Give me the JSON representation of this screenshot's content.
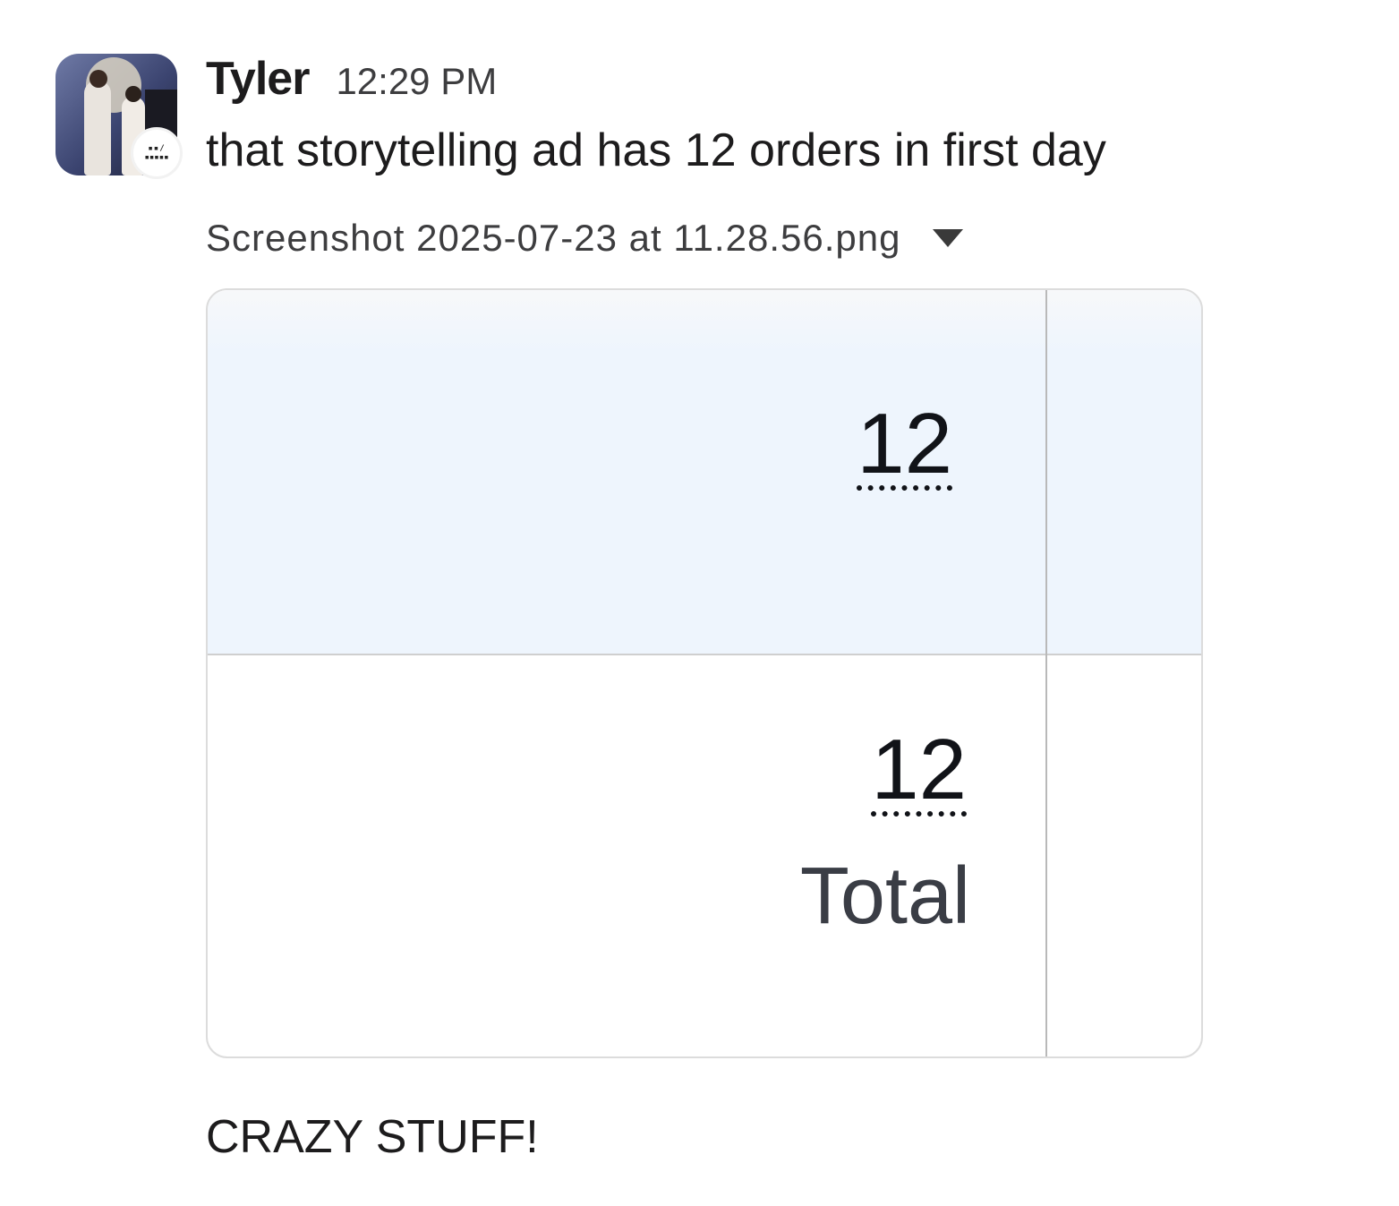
{
  "message": {
    "author": "Tyler",
    "time": "12:29 PM",
    "text": "that storytelling ad has 12 orders in first day",
    "followup": "CRAZY STUFF!"
  },
  "attachment": {
    "file_name": "Screenshot 2025-07-23 at 11.28.56.png",
    "top_value": "12",
    "bottom_value": "12",
    "total_label": "Total"
  }
}
